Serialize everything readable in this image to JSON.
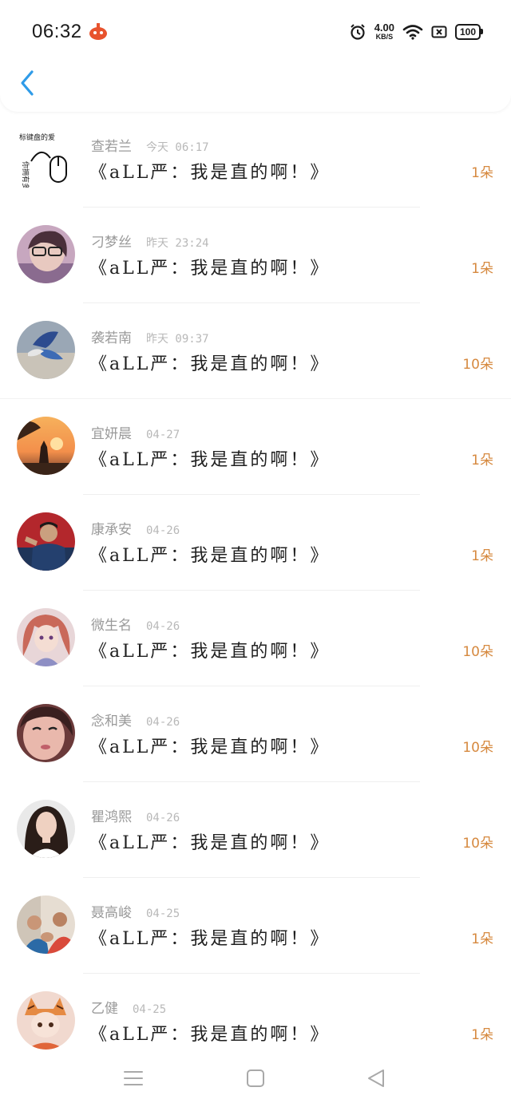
{
  "status_bar": {
    "time": "06:32",
    "net_speed_value": "4.00",
    "net_speed_unit": "KB/S",
    "battery": "100"
  },
  "colors": {
    "accent": "#2f9be8",
    "amount": "#d6893f",
    "text": "#1f1f1f",
    "muted": "#9a9a9a"
  },
  "records": [
    {
      "name": "查若兰",
      "date": "今天 06:17",
      "title": "《aLL严：我是直的啊！》",
      "amount": "1朵",
      "avatar_text_1": "标键盘的爱",
      "avatar_text_2": "你拥有多"
    },
    {
      "name": "刁梦丝",
      "date": "昨天 23:24",
      "title": "《aLL严：我是直的啊！》",
      "amount": "1朵"
    },
    {
      "name": "袭若南",
      "date": "昨天 09:37",
      "title": "《aLL严：我是直的啊！》",
      "amount": "10朵"
    },
    {
      "name": "宜妍晨",
      "date": "04-27",
      "title": "《aLL严：我是直的啊！》",
      "amount": "1朵"
    },
    {
      "name": "康承安",
      "date": "04-26",
      "title": "《aLL严：我是直的啊！》",
      "amount": "1朵"
    },
    {
      "name": "微生名",
      "date": "04-26",
      "title": "《aLL严：我是直的啊！》",
      "amount": "10朵"
    },
    {
      "name": "念和美",
      "date": "04-26",
      "title": "《aLL严：我是直的啊！》",
      "amount": "10朵"
    },
    {
      "name": "瞿鸿熙",
      "date": "04-26",
      "title": "《aLL严：我是直的啊！》",
      "amount": "10朵"
    },
    {
      "name": "聂高峻",
      "date": "04-25",
      "title": "《aLL严：我是直的啊！》",
      "amount": "1朵"
    },
    {
      "name": "乙健",
      "date": "04-25",
      "title": "《aLL严：我是直的啊！》",
      "amount": "1朵"
    }
  ],
  "icons": {
    "back": "chevron-left-icon",
    "menu": "menu-icon",
    "home": "home-square-icon",
    "back_nav": "triangle-back-icon"
  }
}
